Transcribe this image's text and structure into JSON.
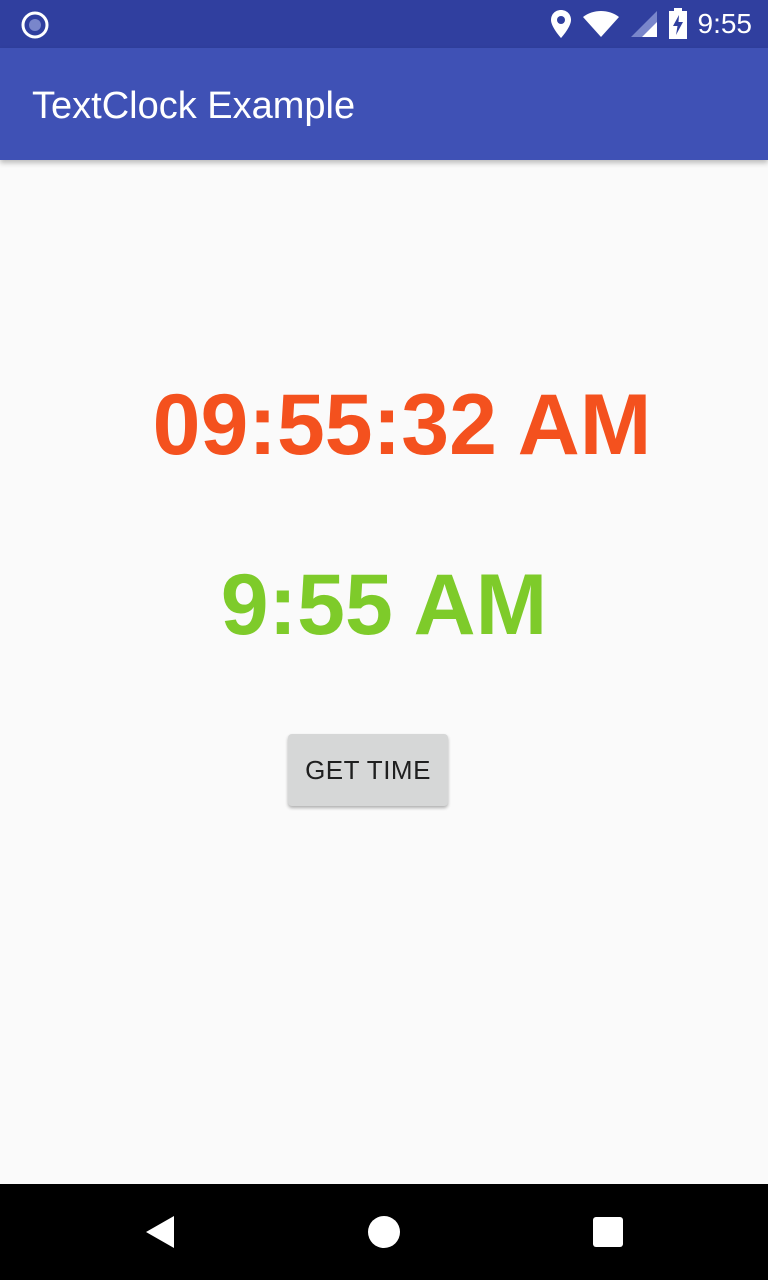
{
  "status_bar": {
    "time": "9:55",
    "icons": [
      "notification-circle-icon",
      "location-pin-icon",
      "wifi-icon",
      "cell-signal-icon",
      "battery-charging-icon"
    ]
  },
  "app_bar": {
    "title": "TextClock Example",
    "color": "#3f51b5"
  },
  "main": {
    "clock_full": {
      "text": "09:55:32 AM",
      "color": "#f4511e"
    },
    "clock_short": {
      "text": "9:55 AM",
      "color": "#7ecb2a"
    },
    "get_time_button": {
      "label": "GET TIME"
    }
  },
  "nav_bar": {
    "icons": [
      "back-icon",
      "home-icon",
      "recents-icon"
    ]
  }
}
